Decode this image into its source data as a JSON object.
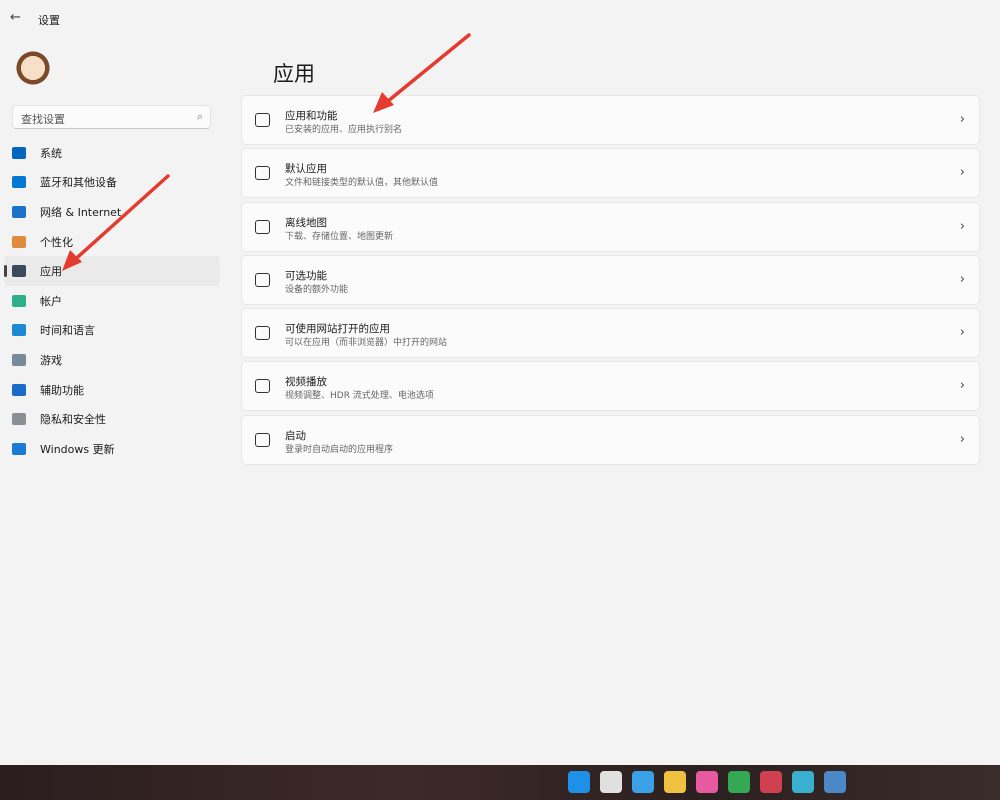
{
  "window": {
    "title": "设置",
    "back_icon": "back-arrow-icon"
  },
  "search": {
    "placeholder": "查找设置",
    "icon": "search-icon"
  },
  "sidebar": {
    "items": [
      {
        "label": "系统",
        "icon": "monitor-icon",
        "color": "#0067c0"
      },
      {
        "label": "蓝牙和其他设备",
        "icon": "bluetooth-icon",
        "color": "#0078d4"
      },
      {
        "label": "网络 & Internet",
        "icon": "wifi-icon",
        "color": "#1a73c8"
      },
      {
        "label": "个性化",
        "icon": "brush-icon",
        "color": "#e08a3c"
      },
      {
        "label": "应用",
        "icon": "apps-icon",
        "color": "#3a4a5c",
        "selected": true
      },
      {
        "label": "帐户",
        "icon": "person-icon",
        "color": "#2bb08a"
      },
      {
        "label": "时间和语言",
        "icon": "globe-clock-icon",
        "color": "#1a8ad4"
      },
      {
        "label": "游戏",
        "icon": "gamepad-icon",
        "color": "#7a8a9a"
      },
      {
        "label": "辅助功能",
        "icon": "accessibility-icon",
        "color": "#1a6ac8"
      },
      {
        "label": "隐私和安全性",
        "icon": "shield-icon",
        "color": "#8a8f96"
      },
      {
        "label": "Windows 更新",
        "icon": "update-icon",
        "color": "#1a7ad4"
      }
    ]
  },
  "main": {
    "title": "应用",
    "cards": [
      {
        "title": "应用和功能",
        "subtitle": "已安装的应用、应用执行别名",
        "icon": "list-icon"
      },
      {
        "title": "默认应用",
        "subtitle": "文件和链接类型的默认值，其他默认值",
        "icon": "default-app-icon"
      },
      {
        "title": "离线地图",
        "subtitle": "下载、存储位置、地图更新",
        "icon": "map-download-icon"
      },
      {
        "title": "可选功能",
        "subtitle": "设备的额外功能",
        "icon": "add-grid-icon"
      },
      {
        "title": "可使用网站打开的应用",
        "subtitle": "可以在应用（而非浏览器）中打开的网站",
        "icon": "open-external-icon"
      },
      {
        "title": "视频播放",
        "subtitle": "视频调整、HDR 流式处理、电池选项",
        "icon": "video-icon"
      },
      {
        "title": "启动",
        "subtitle": "登录时自动启动的应用程序",
        "icon": "startup-icon"
      }
    ]
  },
  "taskbar": {
    "icons": [
      {
        "name": "start-icon",
        "color": "#1e90e8"
      },
      {
        "name": "search-icon",
        "color": "#e0e0e0"
      },
      {
        "name": "widgets-icon",
        "color": "#3aa0e8"
      },
      {
        "name": "file-explorer-icon",
        "color": "#f0c040"
      },
      {
        "name": "color-app-icon",
        "color": "#e85aa0"
      },
      {
        "name": "chrome-icon",
        "color": "#34a853"
      },
      {
        "name": "app-icon",
        "color": "#d04050"
      },
      {
        "name": "paint-icon",
        "color": "#3ab0d0"
      },
      {
        "name": "settings-icon",
        "color": "#4a88c8"
      }
    ]
  },
  "annotation_color": "#e53a2e"
}
